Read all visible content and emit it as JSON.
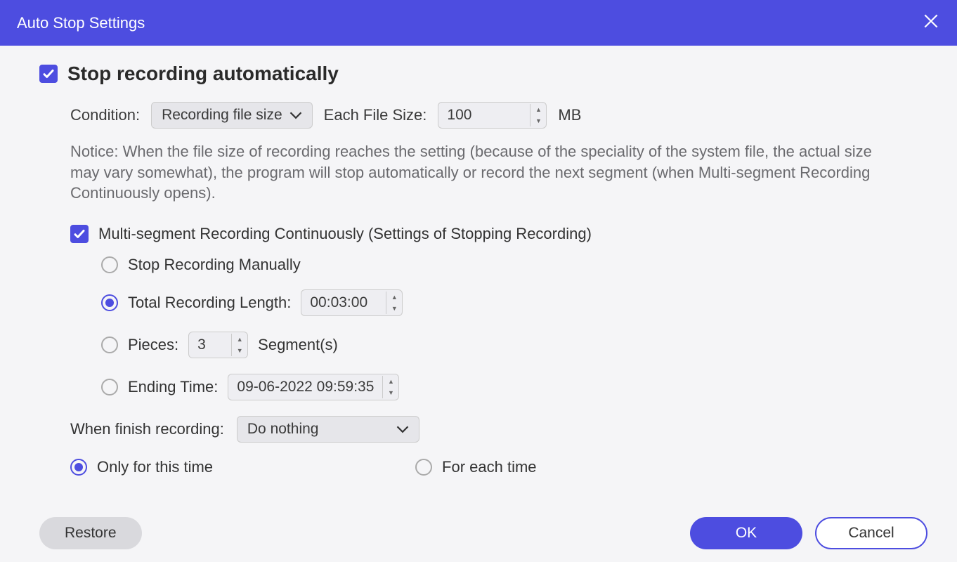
{
  "titlebar": {
    "title": "Auto Stop Settings"
  },
  "main": {
    "checkbox_checked": true,
    "title": "Stop recording automatically",
    "condition_label": "Condition:",
    "condition_value": "Recording file size",
    "each_file_label": "Each File Size:",
    "each_file_value": "100",
    "each_file_unit": "MB",
    "notice": "Notice: When the file size of recording reaches the setting (because of the speciality of the system file, the actual size may vary somewhat), the program will stop automatically or record the next segment (when Multi-segment Recording Continuously opens)."
  },
  "multi": {
    "checkbox_checked": true,
    "label": "Multi-segment Recording Continuously (Settings of Stopping Recording)",
    "options": {
      "stop_manually": "Stop Recording Manually",
      "total_length_label": "Total Recording Length:",
      "total_length_value": "00:03:00",
      "pieces_label": "Pieces:",
      "pieces_value": "3",
      "pieces_unit": "Segment(s)",
      "ending_time_label": "Ending Time:",
      "ending_time_value": "09-06-2022 09:59:35"
    },
    "selected_option": "total_length"
  },
  "finish": {
    "label": "When finish recording:",
    "value": "Do nothing"
  },
  "time_scope": {
    "only_this": "Only for this time",
    "each_time": "For each time",
    "selected": "only_this"
  },
  "buttons": {
    "restore": "Restore",
    "ok": "OK",
    "cancel": "Cancel"
  }
}
